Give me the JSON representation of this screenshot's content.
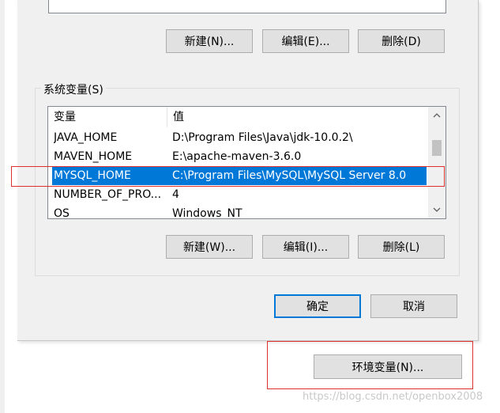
{
  "user_section": {
    "buttons": {
      "new": "新建(N)...",
      "edit": "编辑(E)...",
      "delete": "删除(D)"
    }
  },
  "system_section": {
    "group_label": "系统变量(S)",
    "columns": {
      "name": "变量",
      "value": "值"
    },
    "rows": [
      {
        "name": "JAVA_HOME",
        "value": "D:\\Program Files\\Java\\jdk-10.0.2\\"
      },
      {
        "name": "MAVEN_HOME",
        "value": "E:\\apache-maven-3.6.0"
      },
      {
        "name": "MYSQL_HOME",
        "value": "C:\\Program Files\\MySQL\\MySQL Server 8.0"
      },
      {
        "name": "NUMBER_OF_PRO...",
        "value": "4"
      },
      {
        "name": "OS",
        "value": "Windows_NT"
      }
    ],
    "selected_row": 2,
    "buttons": {
      "new": "新建(W)...",
      "edit": "编辑(I)...",
      "delete": "删除(L)"
    }
  },
  "dialog_buttons": {
    "ok": "确定",
    "cancel": "取消"
  },
  "env_button": "环境变量(N)...",
  "watermark": "https://blog.csdn.net/openbox2008",
  "colors": {
    "selection": "#0078d7",
    "highlight_box": "#e0302b",
    "primary_border": "#0078d7"
  },
  "icons": {
    "scroll_up": "chevron-up-icon",
    "scroll_down": "chevron-down-icon"
  }
}
